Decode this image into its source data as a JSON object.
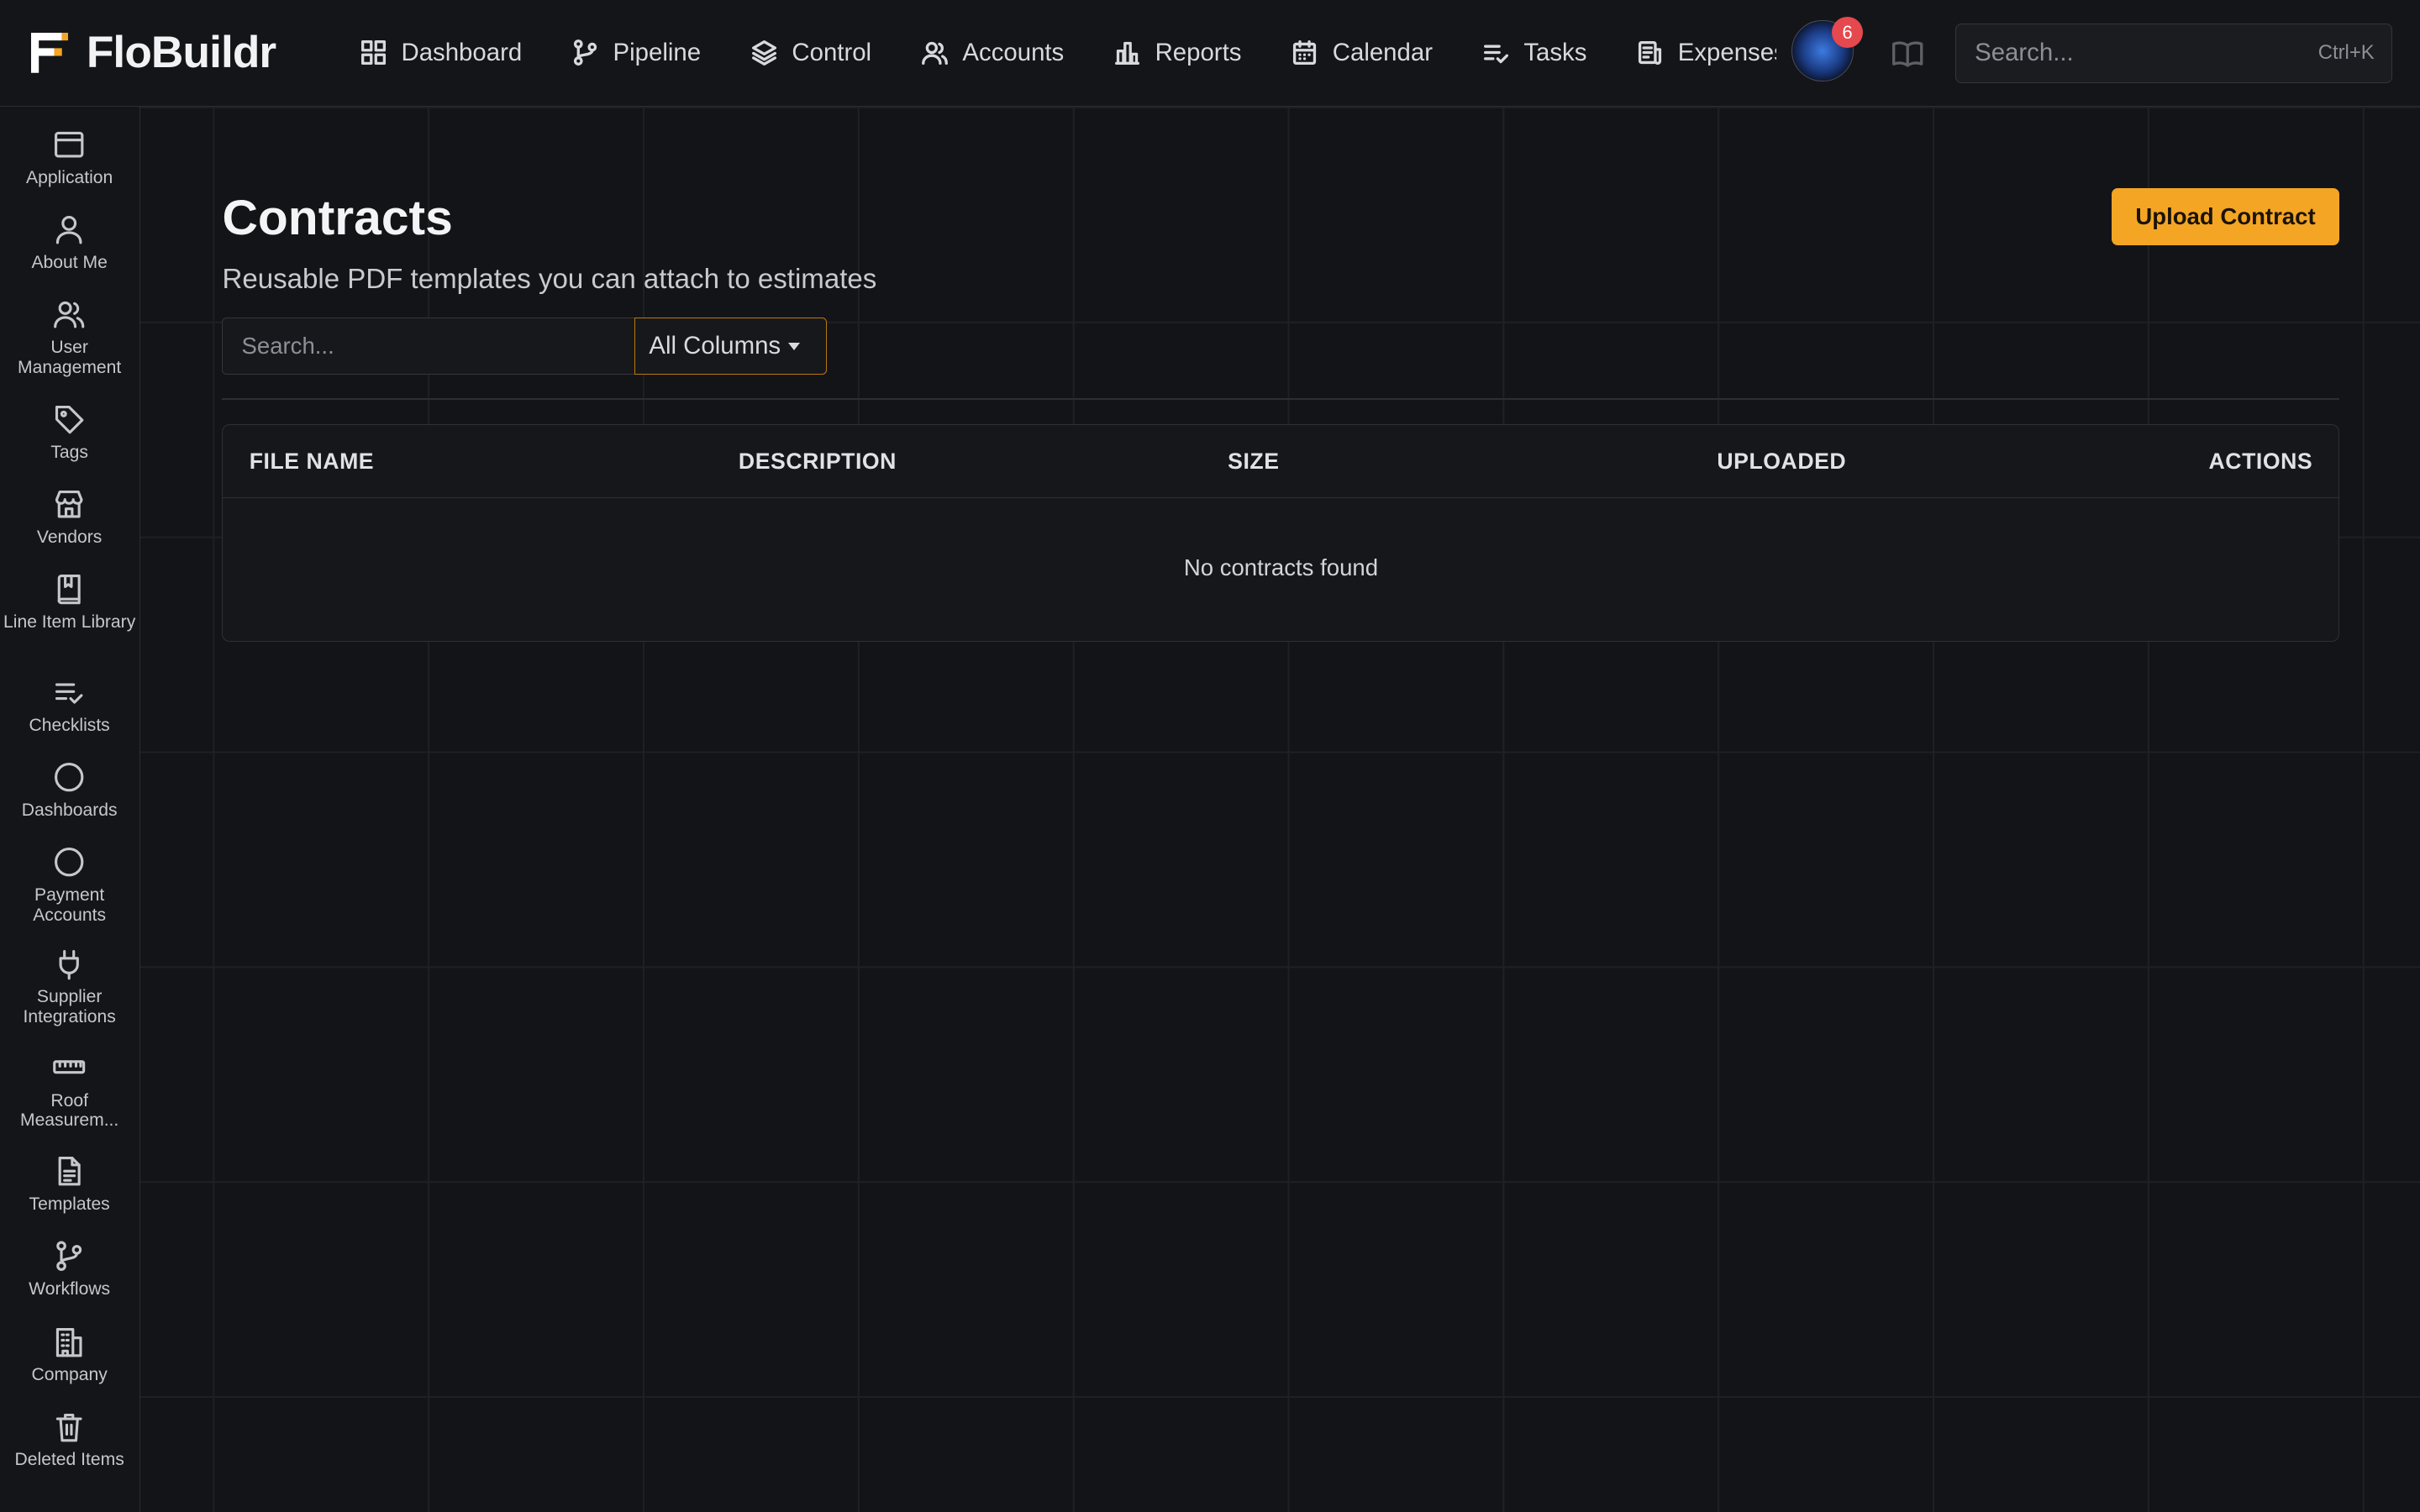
{
  "app": {
    "name": "FloBuildr"
  },
  "topnav": {
    "items": [
      {
        "label": "Dashboard",
        "icon": "grid-icon"
      },
      {
        "label": "Pipeline",
        "icon": "git-branch-icon"
      },
      {
        "label": "Control",
        "icon": "layers-icon"
      },
      {
        "label": "Accounts",
        "icon": "users-icon"
      },
      {
        "label": "Reports",
        "icon": "bar-chart-icon"
      },
      {
        "label": "Calendar",
        "icon": "calendar-icon"
      },
      {
        "label": "Tasks",
        "icon": "list-check-icon"
      },
      {
        "label": "Expenses",
        "icon": "receipt-icon"
      }
    ],
    "notification_count": "6",
    "search": {
      "placeholder": "Search...",
      "shortcut": "Ctrl+K"
    }
  },
  "sidebar": {
    "items": [
      {
        "label": "Application",
        "icon": "window-icon"
      },
      {
        "label": "About Me",
        "icon": "user-icon"
      },
      {
        "label": "User Management",
        "icon": "users-icon"
      },
      {
        "label": "Tags",
        "icon": "tag-icon"
      },
      {
        "label": "Vendors",
        "icon": "store-icon"
      },
      {
        "label": "Line Item Library",
        "icon": "book-icon"
      },
      {
        "label": "Checklists",
        "icon": "list-check-icon"
      },
      {
        "label": "Dashboards",
        "icon": "circle-icon"
      },
      {
        "label": "Payment Accounts",
        "icon": "circle-icon"
      },
      {
        "label": "Supplier Integrations",
        "icon": "plug-icon"
      },
      {
        "label": "Roof Measurem...",
        "icon": "ruler-icon"
      },
      {
        "label": "Templates",
        "icon": "file-text-icon"
      },
      {
        "label": "Workflows",
        "icon": "git-branch-icon"
      },
      {
        "label": "Company",
        "icon": "building-icon"
      },
      {
        "label": "Deleted Items",
        "icon": "trash-icon"
      }
    ]
  },
  "page": {
    "title": "Contracts",
    "subtitle": "Reusable PDF templates you can attach to estimates",
    "upload_label": "Upload Contract",
    "search_placeholder": "Search...",
    "column_filter": "All Columns"
  },
  "table": {
    "columns": [
      "FILE NAME",
      "DESCRIPTION",
      "SIZE",
      "UPLOADED",
      "ACTIONS"
    ],
    "empty_message": "No contracts found"
  },
  "colors": {
    "accent": "#f5a524",
    "background": "#131417",
    "badge": "#e5484d"
  }
}
